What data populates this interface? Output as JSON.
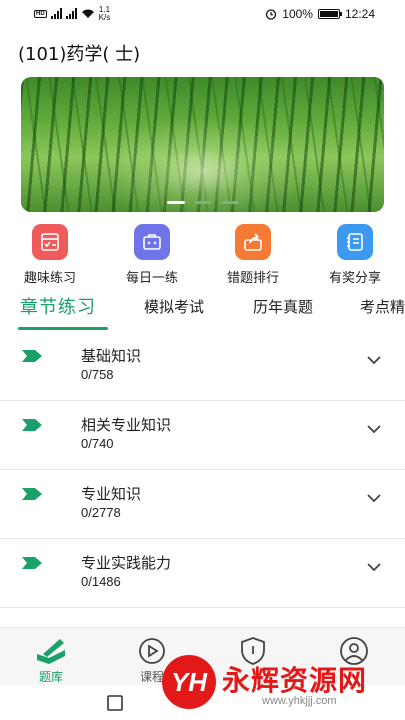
{
  "status_bar": {
    "speed_value": "1.1",
    "speed_unit": "K/s",
    "network": "4G",
    "battery": "100%",
    "time": "12:24",
    "icons": [
      "signal-icon",
      "wifi-icon",
      "alarm-icon",
      "battery-icon"
    ]
  },
  "header": {
    "title": "(101)药学( 士)"
  },
  "banner": {
    "slide_count": 3,
    "active_slide": 1
  },
  "quick_actions": [
    {
      "label": "趣味练习",
      "icon": "checklist-icon",
      "color": "#ef5a5a"
    },
    {
      "label": "每日一练",
      "icon": "briefcase-icon",
      "color": "#6f75e8"
    },
    {
      "label": "错题排行",
      "icon": "share-box-icon",
      "color": "#f57a35"
    },
    {
      "label": "有奖分享",
      "icon": "notebook-icon",
      "color": "#3d98f0"
    }
  ],
  "tabs": [
    {
      "label": "章节练习",
      "active": true
    },
    {
      "label": "模拟考试",
      "active": false
    },
    {
      "label": "历年真题",
      "active": false
    },
    {
      "label": "考点精",
      "active": false
    }
  ],
  "chapters": [
    {
      "name": "基础知识",
      "count": "0/758"
    },
    {
      "name": "相关专业知识",
      "count": "0/740"
    },
    {
      "name": "专业知识",
      "count": "0/2778"
    },
    {
      "name": "专业实践能力",
      "count": "0/1486"
    }
  ],
  "bottom_nav": [
    {
      "label": "题库",
      "icon": "book-pen-icon",
      "active": true
    },
    {
      "label": "课程",
      "icon": "play-icon",
      "active": false
    },
    {
      "label": "",
      "icon": "shield-icon",
      "active": false
    },
    {
      "label": "",
      "icon": "user-icon",
      "active": false
    }
  ],
  "watermark": {
    "badge": "YH",
    "text": "永辉资源网",
    "url": "www.yhkjjj.com"
  },
  "colors": {
    "accent": "#1aa068",
    "watermark": "#e31919"
  }
}
